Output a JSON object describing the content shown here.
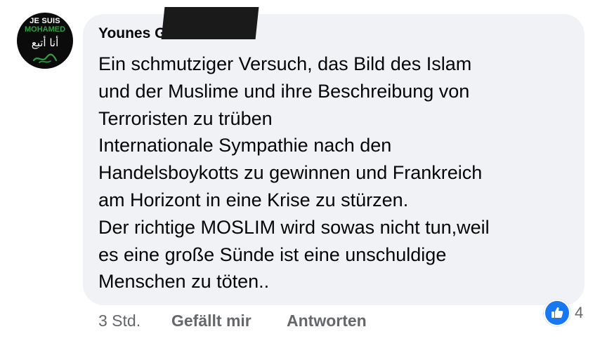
{
  "avatar": {
    "line1": "JE SUIS",
    "line2": "MOHAMED",
    "line3": "أنا أتبع"
  },
  "comment": {
    "author": "Younes Gh",
    "lines": [
      "Ein schmutziger Versuch, das Bild des Islam",
      "und der Muslime und ihre Beschreibung von",
      "Terroristen zu trüben",
      "Internationale Sympathie nach den",
      "Handelsboykotts zu gewinnen und Frankreich",
      "am Horizont in eine Krise zu stürzen.",
      "Der richtige MOSLIM wird sowas nicht tun,weil",
      "es eine große Sünde ist eine unschuldige",
      "Menschen zu töten.."
    ]
  },
  "actions": {
    "timestamp": "3 Std.",
    "like_label": "Gefällt mir",
    "reply_label": "Antworten"
  },
  "reactions": {
    "icon": "thumbs-up-icon",
    "count": "4",
    "color": "#1877f2"
  },
  "colors": {
    "bubble": "#f0f2f5",
    "text": "#050505",
    "muted": "#65676b",
    "avatar_accent": "#2ea043"
  }
}
